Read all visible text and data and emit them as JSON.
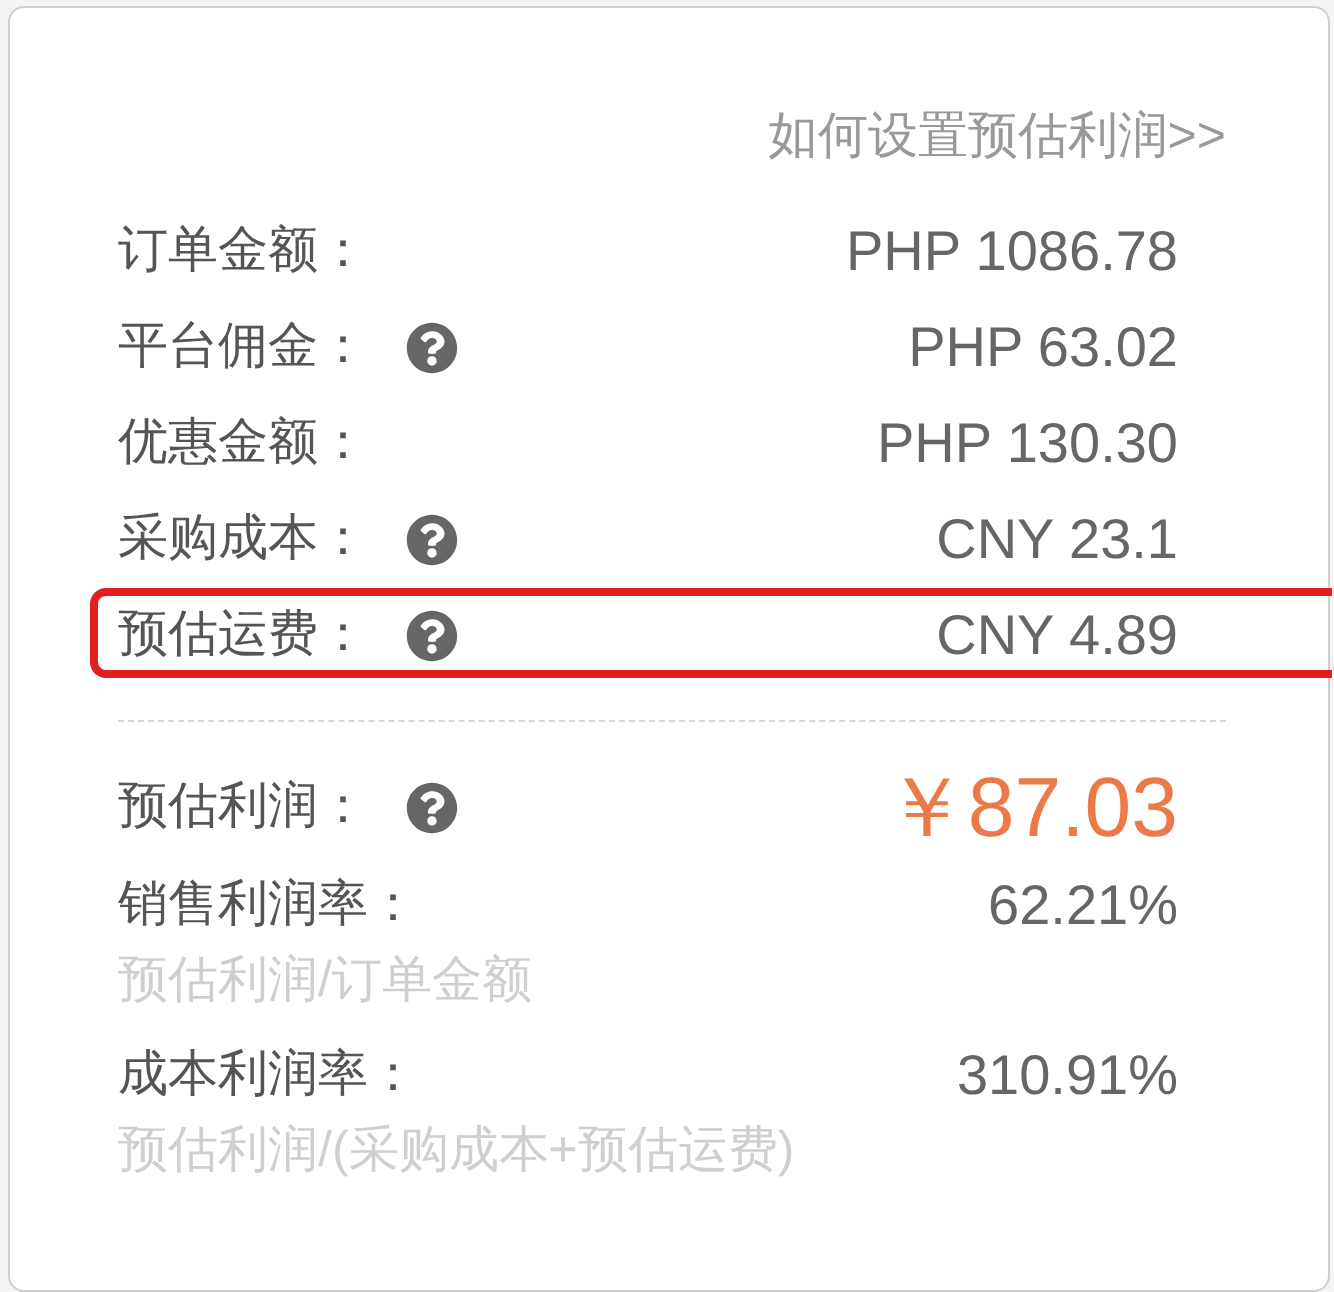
{
  "help_link": "如何设置预估利润>>",
  "cost_rows": [
    {
      "label": "订单金额：",
      "has_help": false,
      "value": "PHP 1086.78",
      "highlighted": false
    },
    {
      "label": "平台佣金：",
      "has_help": true,
      "value": "PHP 63.02",
      "highlighted": false
    },
    {
      "label": "优惠金额：",
      "has_help": false,
      "value": "PHP 130.30",
      "highlighted": false
    },
    {
      "label": "采购成本：",
      "has_help": true,
      "value": "CNY 23.1",
      "highlighted": false
    },
    {
      "label": "预估运费：",
      "has_help": true,
      "value": "CNY 4.89",
      "highlighted": true
    }
  ],
  "profit": {
    "label": "预估利润：",
    "has_help": true,
    "value": "￥87.03"
  },
  "ratios": [
    {
      "label": "销售利润率：",
      "value": "62.21%",
      "formula": "预估利润/订单金额"
    },
    {
      "label": "成本利润率：",
      "value": "310.91%",
      "formula": "预估利润/(采购成本+预估运费)"
    }
  ]
}
